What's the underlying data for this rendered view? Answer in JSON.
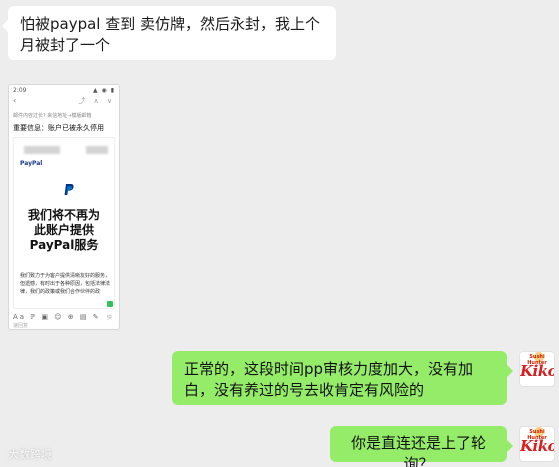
{
  "messages": {
    "incoming_text": "怕被paypal 查到 卖仿牌，然后永封，我上个月被封了一个",
    "outgoing_1": "正常的，这段时间pp审核力度加大，没有加白，没有养过的号去收肯定有风险的",
    "outgoing_2": "你是直连还是上了轮询？"
  },
  "screenshot": {
    "status_time": "2:09",
    "status_icons": "▲ ◉ ▮",
    "back_glyph": "‹",
    "toolbar_glyphs": "⤴ ∧ ∨",
    "from_line": "邮件内容过长? 来信地址→模版邮箱",
    "subject": "重要信息：账户已被永久停用",
    "brand_small": "PayPal",
    "headline_1": "我们将不再为",
    "headline_2": "此账户提供",
    "headline_3": "PayPal服务",
    "body": "我们致力于为客户提供清晰友好的服务，但遗憾，有时出于各种原因，包括法律法律，我们的政策或我们合作伙伴的政",
    "reply_placeholder": "快速回复",
    "bottom_icons": "Aa ℙ ▣ ☺ ⊕ ▤ ✎"
  },
  "avatar": {
    "caption": "Sushi Hunter",
    "name": "Kiko"
  },
  "watermark": "大数跨境",
  "colors": {
    "background": "#ededed",
    "incoming_bubble": "#ffffff",
    "outgoing_bubble": "#95ec69",
    "paypal_blue": "#003087",
    "avatar_red": "#d81e1e"
  }
}
